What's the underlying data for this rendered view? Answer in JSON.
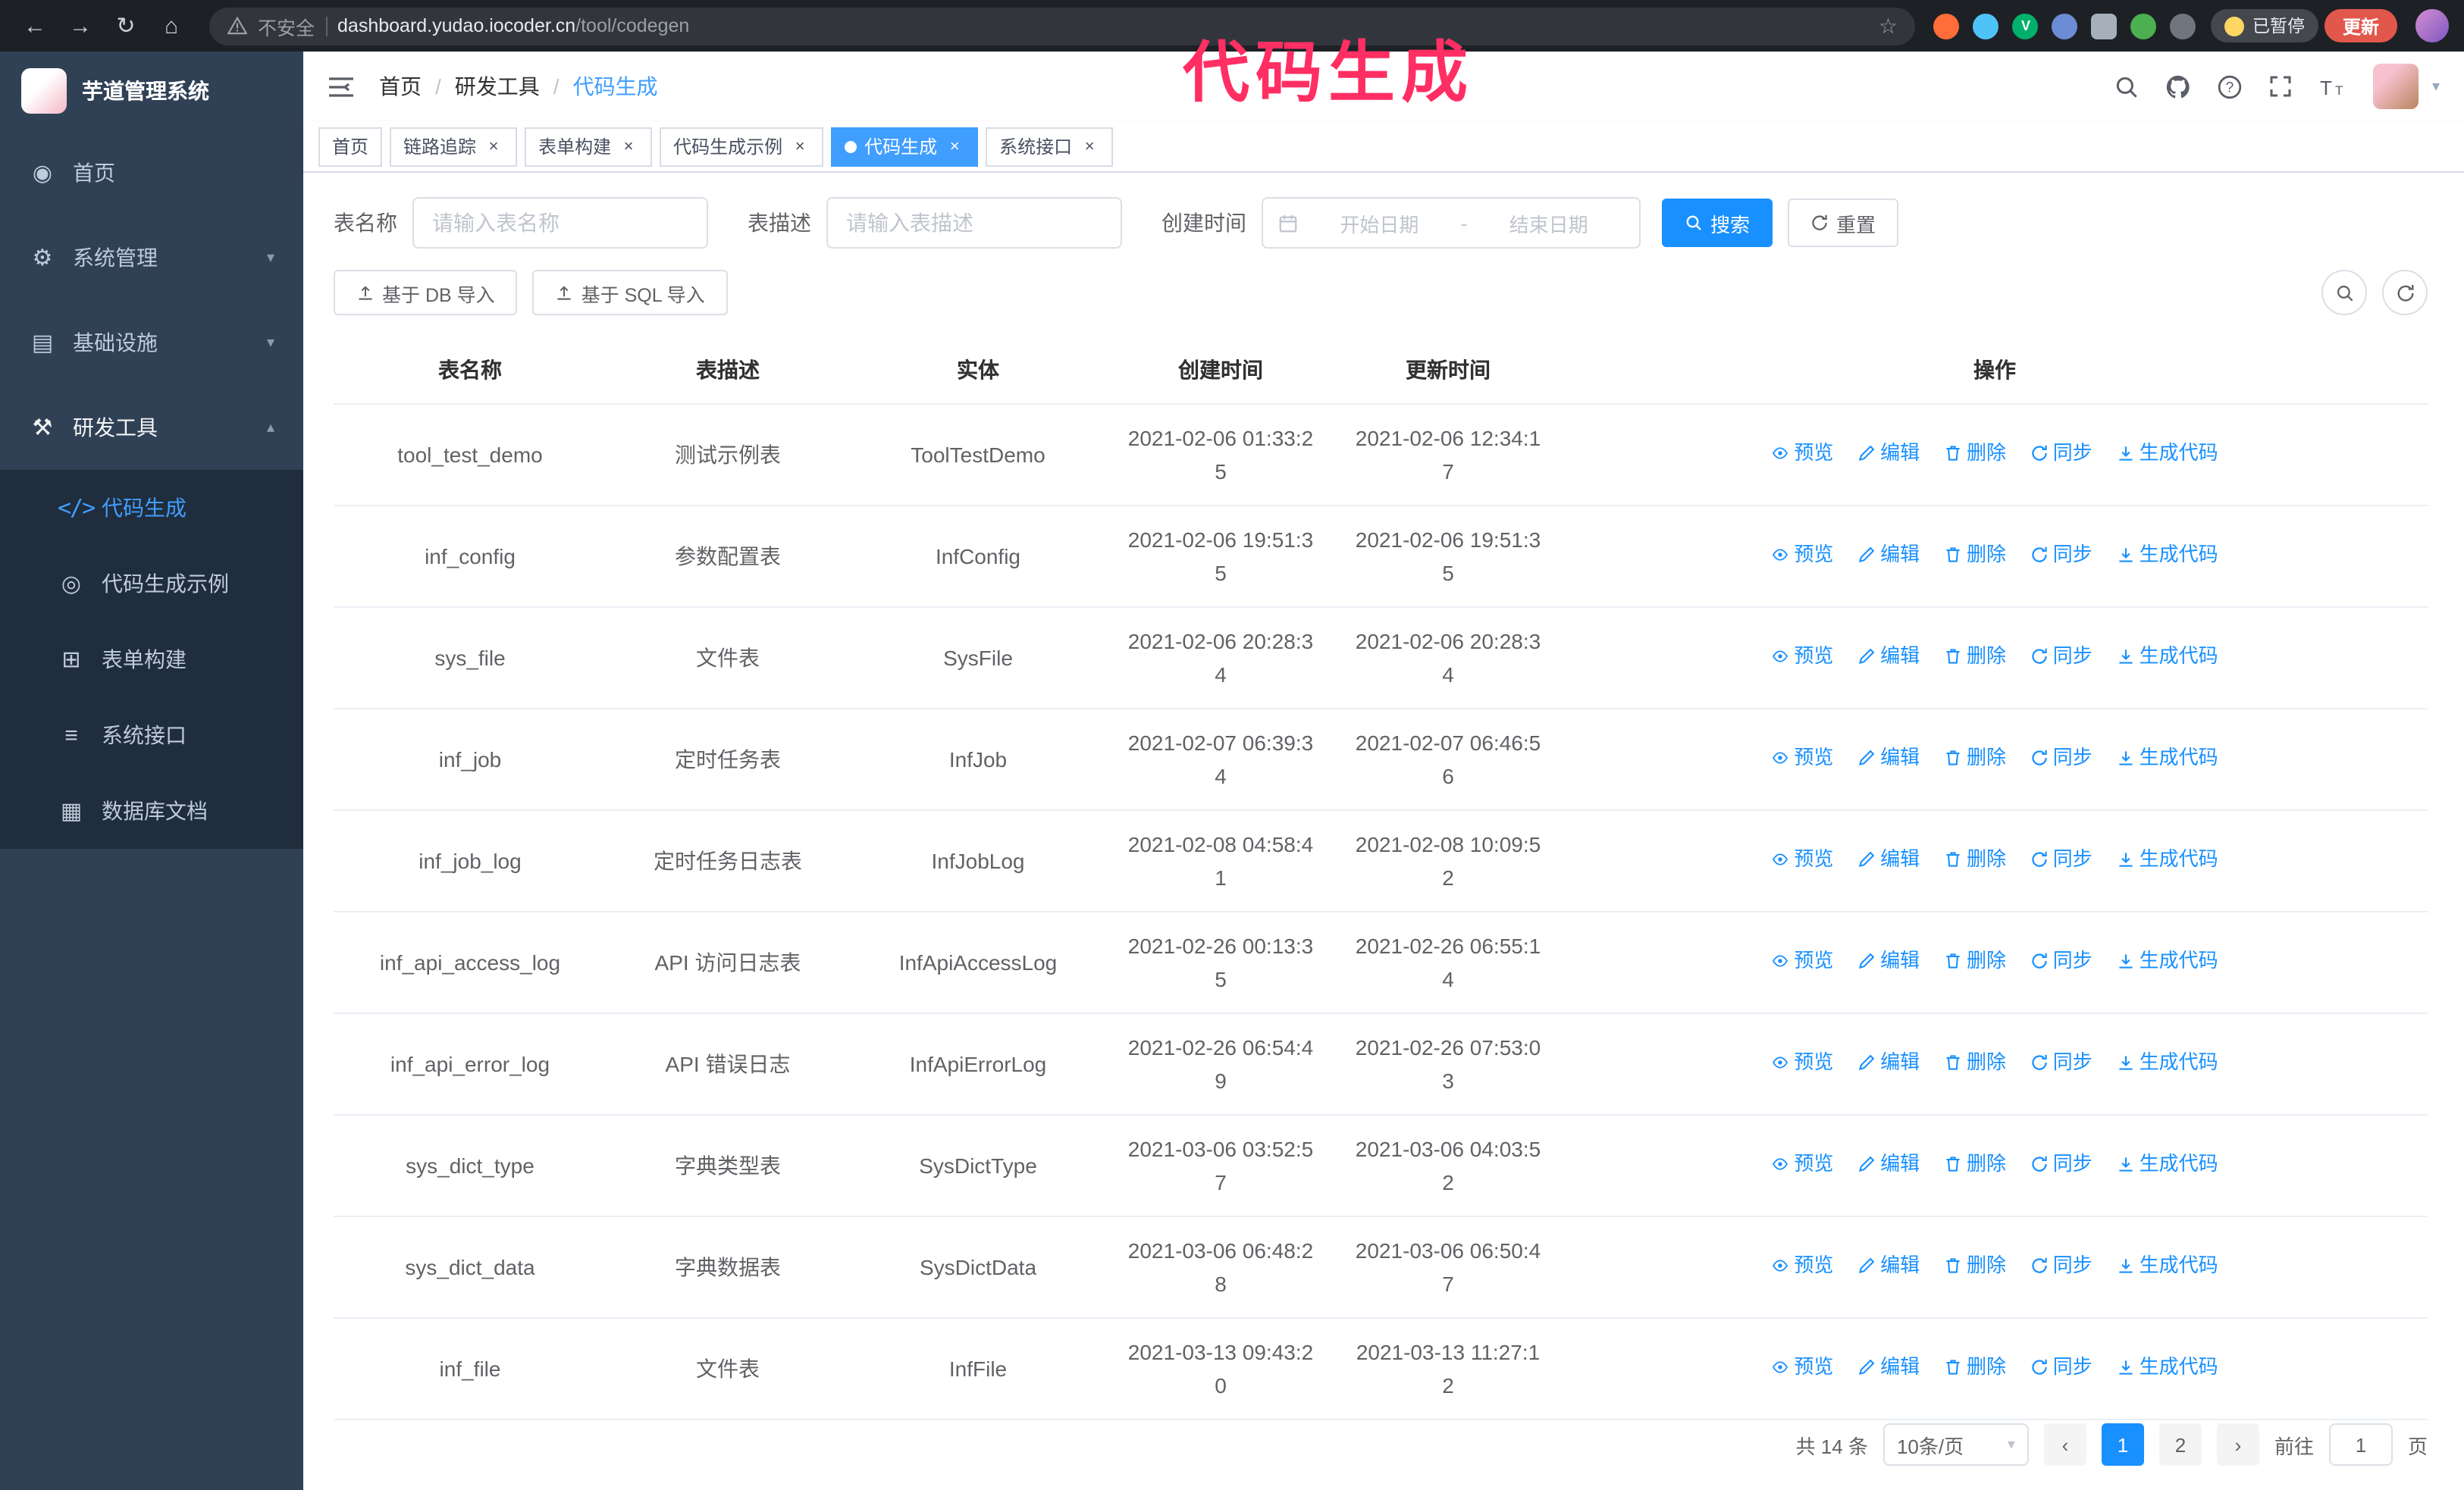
{
  "annotation": {
    "text": "代码生成",
    "color": "#ff2e63"
  },
  "browser": {
    "security_label": "不安全",
    "url_host": "dashboard.yudao.iocoder.cn",
    "url_path": "/tool/codegen",
    "paused_badge": "已暂停",
    "update_button": "更新"
  },
  "icons": {
    "back": "←",
    "forward": "→",
    "reload": "↻",
    "home": "⌂",
    "star": "☆",
    "close": "×",
    "menu_home": "◉",
    "menu_system": "⚙",
    "menu_infra": "▤",
    "menu_tools": "⚒",
    "sub_codegen": "</>",
    "sub_demo": "◎",
    "sub_form": "⊞",
    "sub_api": "≡",
    "sub_db": "▦",
    "chevron_down": "▾",
    "chevron_up": "▴",
    "select_caret": "▾",
    "avatar_caret": "▾",
    "prev": "‹",
    "next": "›"
  },
  "sidebar": {
    "app_title": "芋道管理系统",
    "items": [
      {
        "label": "首页"
      },
      {
        "label": "系统管理",
        "expandable": true
      },
      {
        "label": "基础设施",
        "expandable": true
      },
      {
        "label": "研发工具",
        "expandable": true,
        "expanded": true
      }
    ],
    "subitems": [
      {
        "label": "代码生成",
        "active": true
      },
      {
        "label": "代码生成示例"
      },
      {
        "label": "表单构建"
      },
      {
        "label": "系统接口"
      },
      {
        "label": "数据库文档"
      }
    ]
  },
  "header": {
    "breadcrumb": [
      "首页",
      "研发工具",
      "代码生成"
    ],
    "separator": "/"
  },
  "tabs": [
    {
      "label": "首页",
      "closable": false
    },
    {
      "label": "链路追踪",
      "closable": true
    },
    {
      "label": "表单构建",
      "closable": true
    },
    {
      "label": "代码生成示例",
      "closable": true
    },
    {
      "label": "代码生成",
      "closable": true,
      "active": true
    },
    {
      "label": "系统接口",
      "closable": true
    }
  ],
  "filters": {
    "table_name_label": "表名称",
    "table_name_placeholder": "请输入表名称",
    "table_desc_label": "表描述",
    "table_desc_placeholder": "请输入表描述",
    "create_time_label": "创建时间",
    "date_start_placeholder": "开始日期",
    "date_separator": "-",
    "date_end_placeholder": "结束日期",
    "search_button": "搜索",
    "reset_button": "重置"
  },
  "toolbar": {
    "import_db_button": "基于 DB 导入",
    "import_sql_button": "基于 SQL 导入"
  },
  "table": {
    "columns": [
      "表名称",
      "表描述",
      "实体",
      "创建时间",
      "更新时间",
      "操作"
    ],
    "actions": [
      "预览",
      "编辑",
      "删除",
      "同步",
      "生成代码"
    ],
    "rows": [
      {
        "name": "tool_test_demo",
        "desc": "测试示例表",
        "entity": "ToolTestDemo",
        "created": "2021-02-06 01:33:25",
        "updated": "2021-02-06 12:34:17"
      },
      {
        "name": "inf_config",
        "desc": "参数配置表",
        "entity": "InfConfig",
        "created": "2021-02-06 19:51:35",
        "updated": "2021-02-06 19:51:35"
      },
      {
        "name": "sys_file",
        "desc": "文件表",
        "entity": "SysFile",
        "created": "2021-02-06 20:28:34",
        "updated": "2021-02-06 20:28:34"
      },
      {
        "name": "inf_job",
        "desc": "定时任务表",
        "entity": "InfJob",
        "created": "2021-02-07 06:39:34",
        "updated": "2021-02-07 06:46:56"
      },
      {
        "name": "inf_job_log",
        "desc": "定时任务日志表",
        "entity": "InfJobLog",
        "created": "2021-02-08 04:58:41",
        "updated": "2021-02-08 10:09:52"
      },
      {
        "name": "inf_api_access_log",
        "desc": "API 访问日志表",
        "entity": "InfApiAccessLog",
        "created": "2021-02-26 00:13:35",
        "updated": "2021-02-26 06:55:14"
      },
      {
        "name": "inf_api_error_log",
        "desc": "API 错误日志",
        "entity": "InfApiErrorLog",
        "created": "2021-02-26 06:54:49",
        "updated": "2021-02-26 07:53:03"
      },
      {
        "name": "sys_dict_type",
        "desc": "字典类型表",
        "entity": "SysDictType",
        "created": "2021-03-06 03:52:57",
        "updated": "2021-03-06 04:03:52"
      },
      {
        "name": "sys_dict_data",
        "desc": "字典数据表",
        "entity": "SysDictData",
        "created": "2021-03-06 06:48:28",
        "updated": "2021-03-06 06:50:47"
      },
      {
        "name": "inf_file",
        "desc": "文件表",
        "entity": "InfFile",
        "created": "2021-03-13 09:43:20",
        "updated": "2021-03-13 11:27:12"
      }
    ]
  },
  "pagination": {
    "total_text": "共 14 条",
    "page_size": "10条/页",
    "pages": [
      "1",
      "2"
    ],
    "current_page": "1",
    "goto_label": "前往",
    "goto_value": "1",
    "goto_suffix": "页"
  },
  "colors": {
    "accent": "#1890ff",
    "sidebar_active": "#409eff",
    "sidebar_bg": "#304156",
    "submenu_bg": "#1f2d3d",
    "annotation": "#ff2e63",
    "update_button": "#e2574c"
  }
}
